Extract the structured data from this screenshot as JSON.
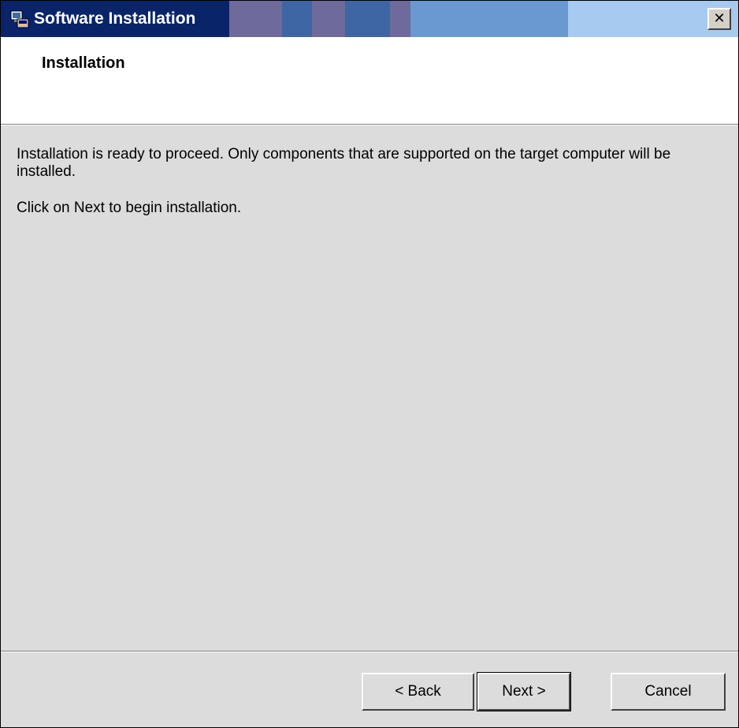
{
  "window": {
    "title": "Software Installation",
    "close_glyph": "✕",
    "icon": "installer-icon"
  },
  "header": {
    "title": "Installation"
  },
  "body": {
    "line1": "Installation is ready to proceed.  Only components that are supported on the target computer will be installed.",
    "line2": "Click on Next to begin installation."
  },
  "buttons": {
    "back": "< Back",
    "next": "Next >",
    "cancel": "Cancel"
  },
  "colors": {
    "title_bar_dark": "#0a246a",
    "title_bar_light": "#a6caf0",
    "dialog_background": "#dcdcdc"
  }
}
